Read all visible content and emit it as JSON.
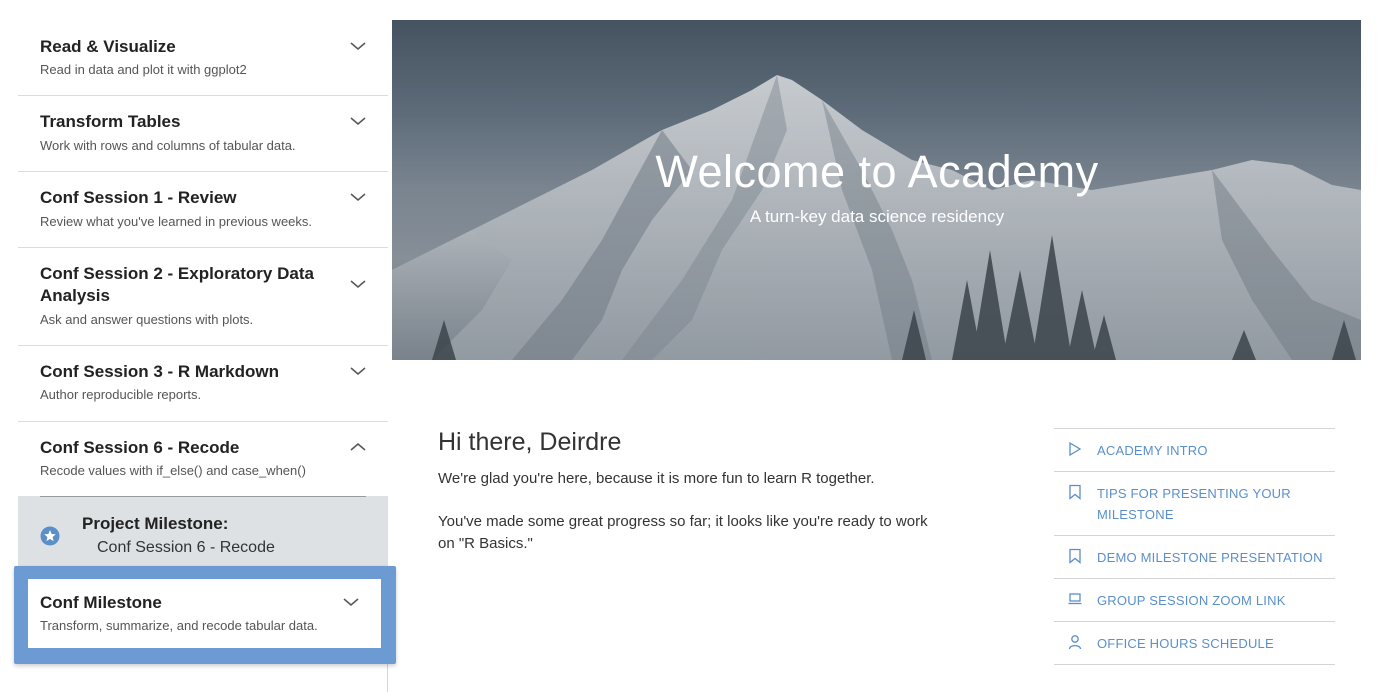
{
  "sidebar": {
    "items": [
      {
        "title": "Read & Visualize",
        "subtitle": "Read in data and plot it with ggplot2",
        "chevron": "chevron-down-icon"
      },
      {
        "title": "Transform Tables",
        "subtitle": "Work with rows and columns of tabular data.",
        "chevron": "chevron-down-icon"
      },
      {
        "title": "Conf Session 1 - Review",
        "subtitle": "Review what you've learned in previous weeks.",
        "chevron": "chevron-down-icon"
      },
      {
        "title": "Conf Session 2 - Exploratory Data Analysis",
        "subtitle": "Ask and answer questions with plots.",
        "chevron": "chevron-down-icon"
      },
      {
        "title": "Conf Session 3 - R Markdown",
        "subtitle": "Author reproducible reports.",
        "chevron": "chevron-down-icon"
      },
      {
        "title": "Conf Session 6 - Recode",
        "subtitle": "Recode values with if_else() and case_when()",
        "chevron": "chevron-up-icon"
      }
    ],
    "milestone": {
      "title": "Project Milestone:",
      "subtitle": "Conf Session 6 - Recode",
      "icon": "star-icon"
    },
    "conf_milestone": {
      "title": "Conf Milestone",
      "subtitle": "Transform, summarize, and recode tabular data.",
      "chevron": "chevron-down-icon"
    }
  },
  "hero": {
    "title": "Welcome to Academy",
    "subtitle": "A turn-key data science residency"
  },
  "main": {
    "greeting": "Hi there, Deirdre",
    "para1": "We're glad you're here, because it is more fun to learn R together.",
    "para2": "You've made some great progress so far; it looks like you're ready to work on \"R Basics.\""
  },
  "links": [
    {
      "label": "ACADEMY INTRO",
      "icon": "play-icon"
    },
    {
      "label": "TIPS FOR PRESENTING YOUR MILESTONE",
      "icon": "bookmark-icon"
    },
    {
      "label": "DEMO MILESTONE PRESENTATION",
      "icon": "bookmark-icon"
    },
    {
      "label": "GROUP SESSION ZOOM LINK",
      "icon": "laptop-icon"
    },
    {
      "label": "OFFICE HOURS SCHEDULE",
      "icon": "person-icon"
    }
  ],
  "colors": {
    "accent": "#5b8fc9",
    "highlight": "#6b9bd2",
    "milestone_bg": "#dde1e4"
  }
}
